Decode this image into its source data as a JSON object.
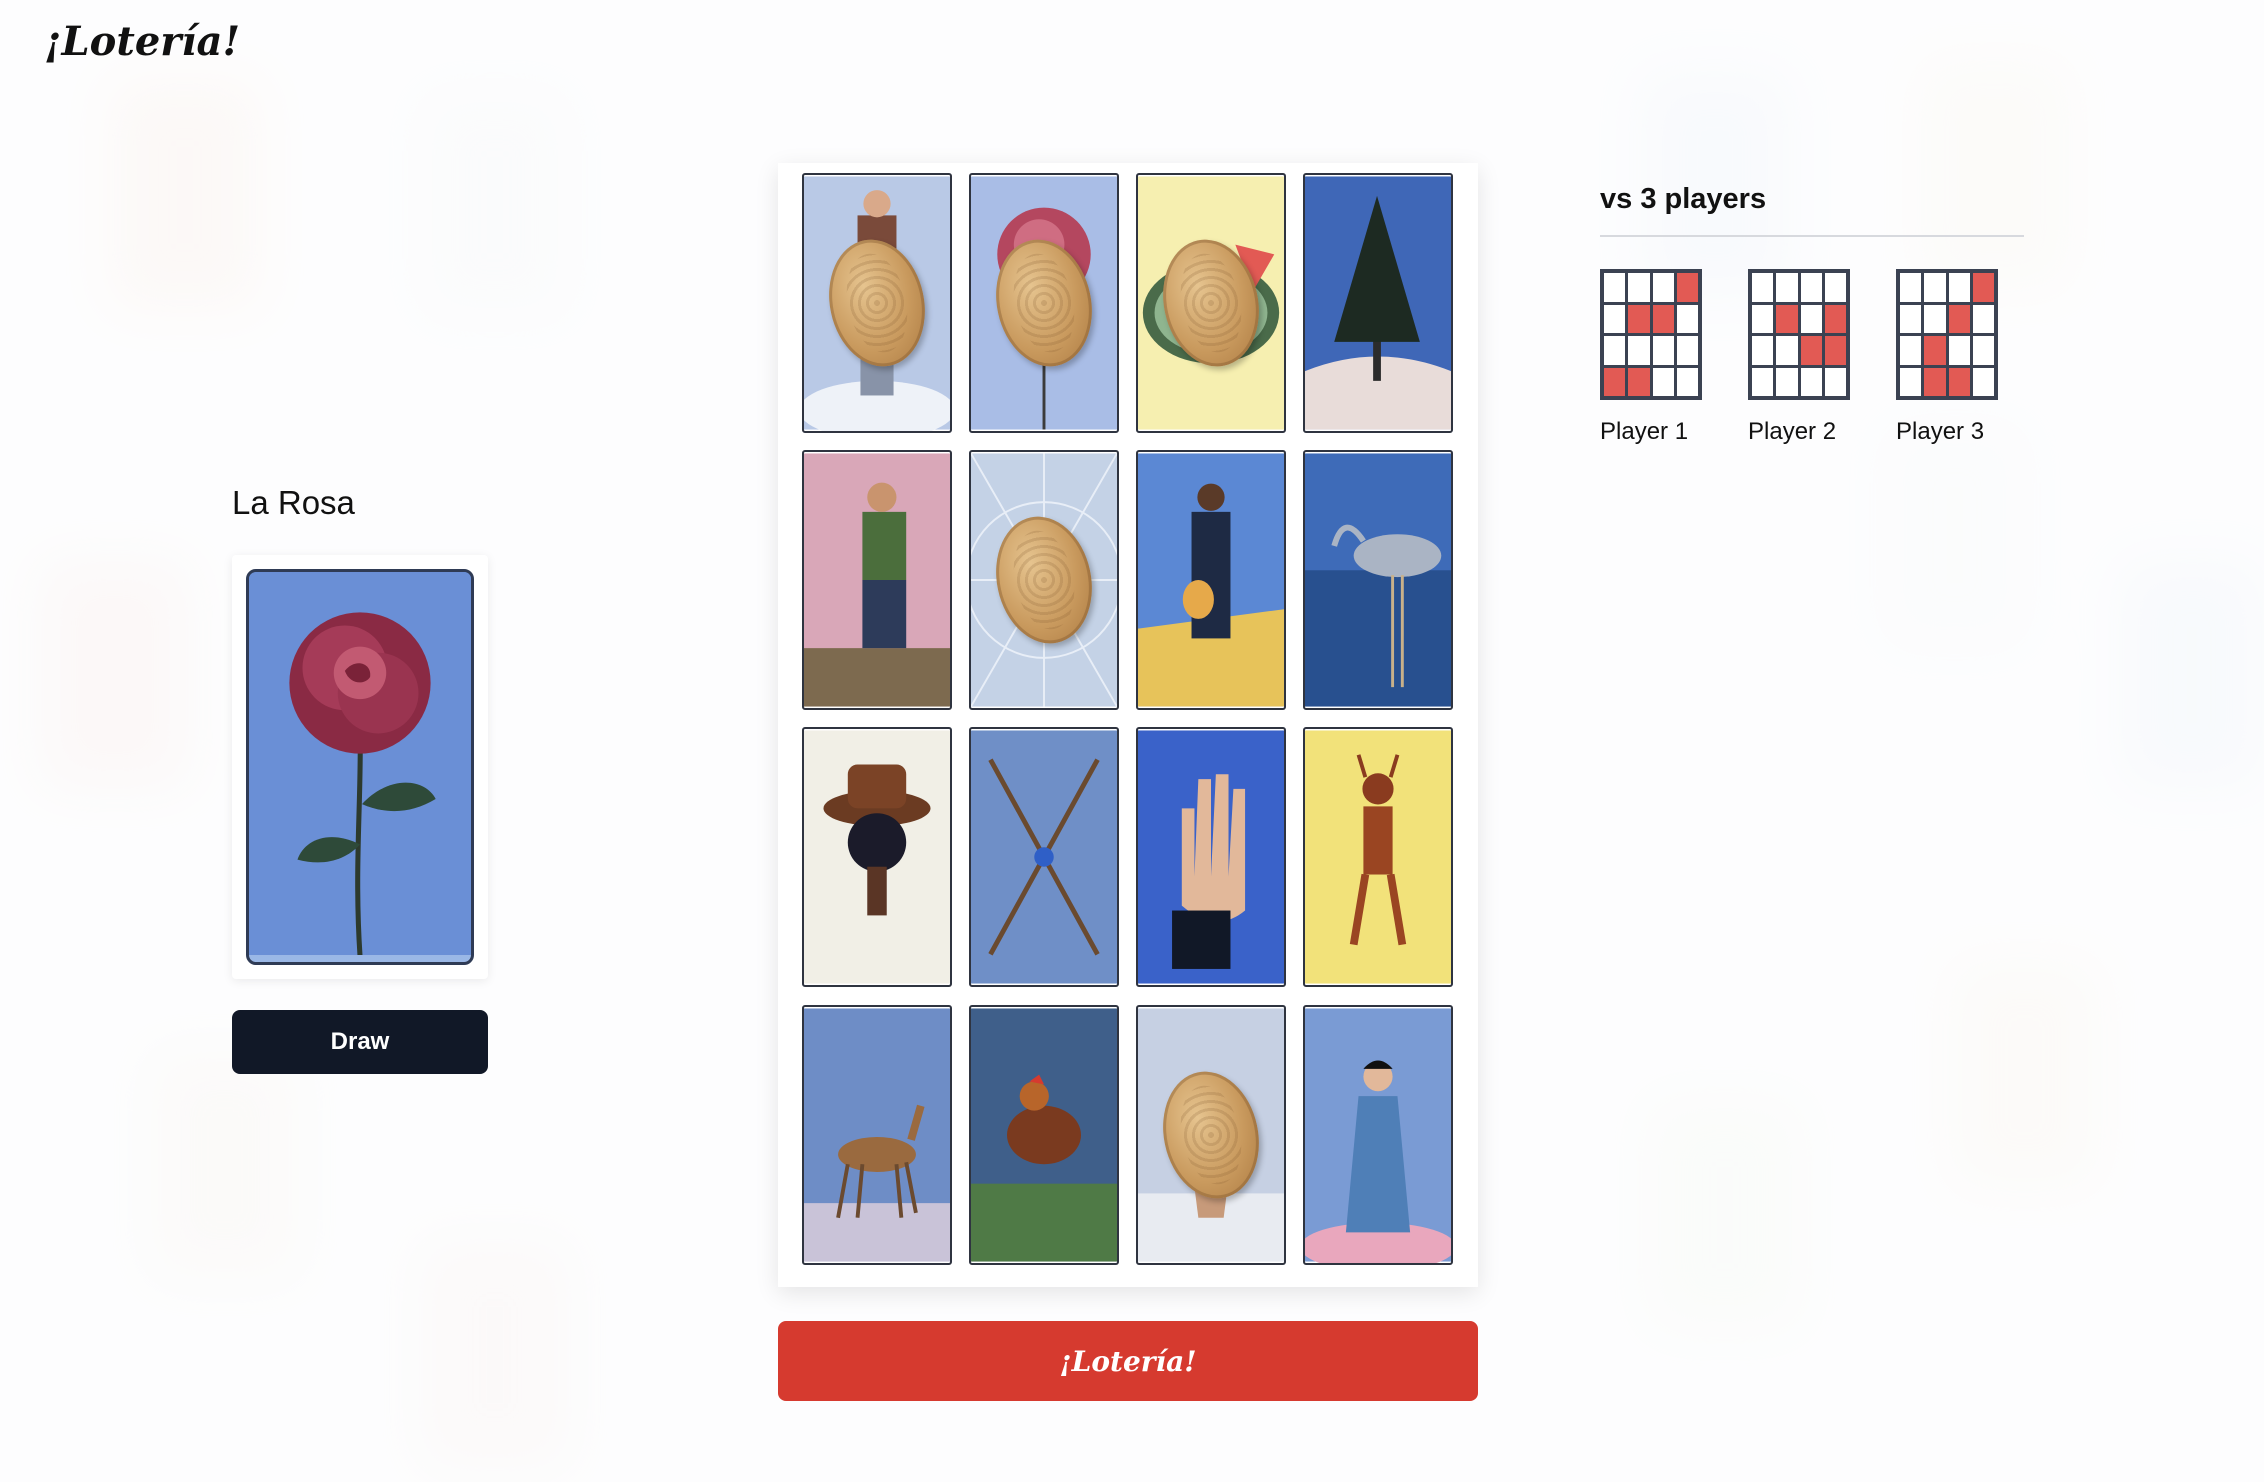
{
  "app": {
    "logo": "¡Lotería!"
  },
  "called_card": {
    "name": "La Rosa",
    "image": "rose-card"
  },
  "draw_button": {
    "label": "Draw"
  },
  "board": {
    "cards": [
      {
        "image": "man-in-clouds-card",
        "marked": true
      },
      {
        "image": "rose-card",
        "marked": true
      },
      {
        "image": "watermelon-card",
        "marked": true
      },
      {
        "image": "pine-tree-card",
        "marked": false
      },
      {
        "image": "drunk-man-card",
        "marked": false
      },
      {
        "image": "spider-web-card",
        "marked": true
      },
      {
        "image": "musician-card",
        "marked": false
      },
      {
        "image": "heron-card",
        "marked": false
      },
      {
        "image": "hat-card",
        "marked": false
      },
      {
        "image": "arrows-card",
        "marked": false
      },
      {
        "image": "hand-card",
        "marked": false
      },
      {
        "image": "devil-card",
        "marked": false
      },
      {
        "image": "deer-card",
        "marked": false
      },
      {
        "image": "rooster-card",
        "marked": false
      },
      {
        "image": "flowerpot-card",
        "marked": true
      },
      {
        "image": "lady-card",
        "marked": false
      }
    ]
  },
  "loteria_button": {
    "label": "¡Lotería!"
  },
  "opponents": {
    "title": "vs 3 players",
    "players": [
      {
        "name": "Player 1",
        "marks": [
          0,
          0,
          0,
          1,
          0,
          1,
          1,
          0,
          0,
          0,
          0,
          0,
          1,
          1,
          0,
          0
        ]
      },
      {
        "name": "Player 2",
        "marks": [
          0,
          0,
          0,
          0,
          0,
          1,
          0,
          1,
          0,
          0,
          1,
          1,
          0,
          0,
          0,
          0
        ]
      },
      {
        "name": "Player 3",
        "marks": [
          0,
          0,
          0,
          1,
          0,
          0,
          1,
          0,
          0,
          1,
          0,
          0,
          0,
          1,
          1,
          0
        ]
      }
    ]
  },
  "colors": {
    "accent": "#d63a2f",
    "dark_button": "#111827",
    "mark": "#e25a54"
  }
}
